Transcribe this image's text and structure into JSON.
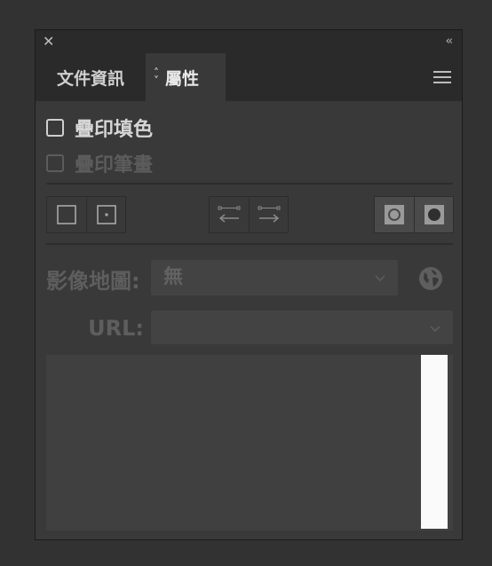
{
  "window": {
    "close_glyph": "✕",
    "collapse_glyph": "‹‹"
  },
  "tabs": [
    {
      "label": "文件資訊",
      "active": false
    },
    {
      "label": "屬性",
      "active": true
    }
  ],
  "options": {
    "overprint_fill": {
      "label": "疊印填色",
      "checked": false,
      "enabled": true
    },
    "overprint_stroke": {
      "label": "疊印筆畫",
      "checked": false,
      "enabled": false
    }
  },
  "toolbar_groups": [
    [
      "hide-center-icon",
      "show-center-icon"
    ],
    [
      "reverse-path-direction-off-icon",
      "reverse-path-direction-on-icon"
    ],
    [
      "nonzero-winding-fill-rule-icon",
      "even-odd-fill-rule-icon"
    ]
  ],
  "image_map": {
    "label": "影像地圖:",
    "value": "無"
  },
  "url": {
    "label": "URL:",
    "value": ""
  },
  "colors": {
    "panel_bg": "#393939",
    "tab_bg": "#2a2a2a",
    "disabled_text": "#5e5e5e",
    "scrollbar": "#fafafa"
  }
}
